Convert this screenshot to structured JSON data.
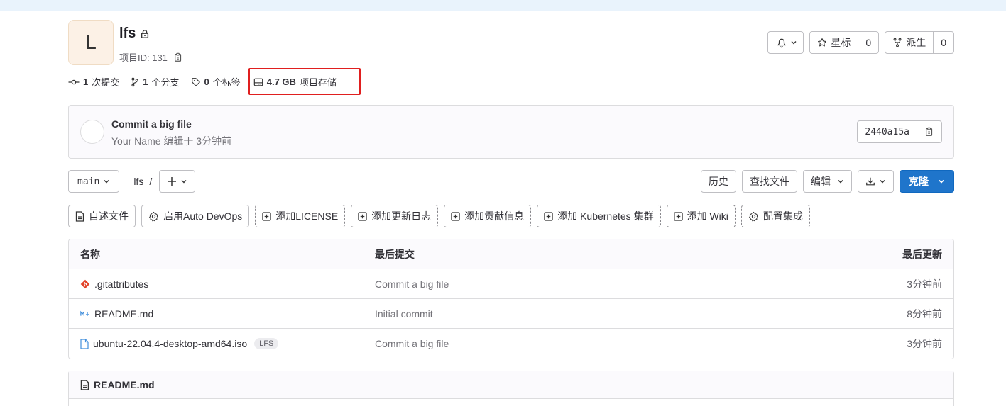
{
  "project": {
    "avatar_letter": "L",
    "name": "lfs",
    "id_label": "项目ID: 131"
  },
  "header_buttons": {
    "notify_icon": "bell-icon",
    "star_label": "星标",
    "star_count": "0",
    "fork_label": "派生",
    "fork_count": "0"
  },
  "stats": {
    "commits_count": "1",
    "commits_label": "次提交",
    "branches_count": "1",
    "branches_label": "个分支",
    "tags_count": "0",
    "tags_label": "个标签",
    "storage_size": "4.7 GB",
    "storage_label": "项目存储"
  },
  "last_commit": {
    "title": "Commit a big file",
    "subtitle": "Your Name 编辑于 3分钟前",
    "sha": "2440a15a"
  },
  "branch_bar": {
    "branch": "main",
    "path": "lfs",
    "path_sep": "/",
    "history": "历史",
    "find_file": "查找文件",
    "edit": "编辑",
    "clone": "克隆"
  },
  "quick_actions": [
    "自述文件",
    "启用Auto DevOps",
    "添加LICENSE",
    "添加更新日志",
    "添加贡献信息",
    "添加 Kubernetes 集群",
    "添加 Wiki",
    "配置集成"
  ],
  "table": {
    "headers": [
      "名称",
      "最后提交",
      "最后更新"
    ],
    "rows": [
      {
        "name": ".gitattributes",
        "icon": "git-icon",
        "commit": "Commit a big file",
        "updated": "3分钟前",
        "badge": ""
      },
      {
        "name": "README.md",
        "icon": "markdown-icon",
        "commit": "Initial commit",
        "updated": "8分钟前",
        "badge": ""
      },
      {
        "name": "ubuntu-22.04.4-desktop-amd64.iso",
        "icon": "file-icon",
        "commit": "Commit a big file",
        "updated": "3分钟前",
        "badge": "LFS"
      }
    ]
  },
  "readme": {
    "title": "README.md"
  },
  "colors": {
    "primary": "#1f75cb",
    "highlight": "#e01f1f",
    "git_icon": "#e24329",
    "md_icon": "#428fdc"
  }
}
